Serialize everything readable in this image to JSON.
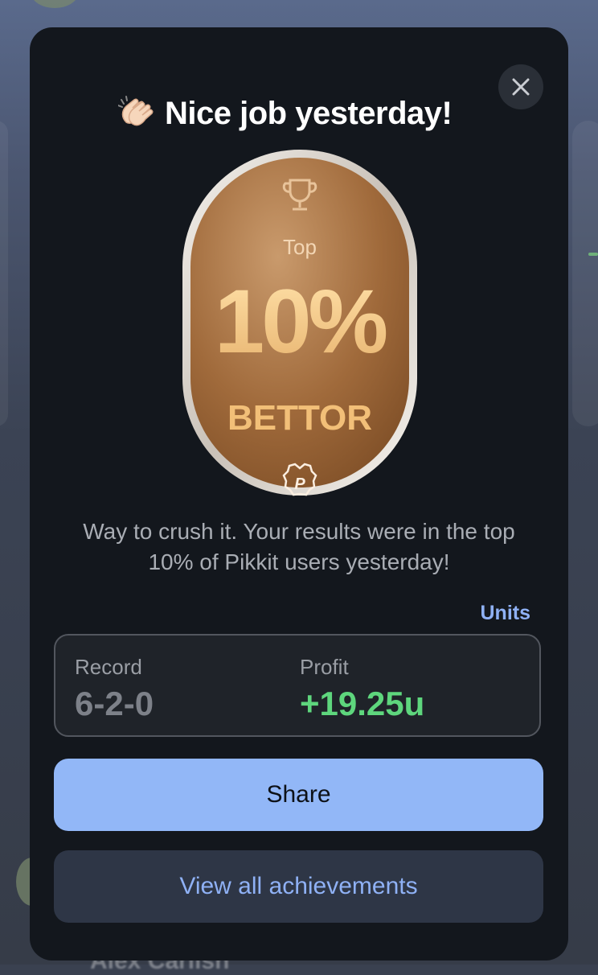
{
  "modal": {
    "title": "Nice job yesterday!",
    "badge": {
      "top_label": "Top",
      "percent": "10%",
      "subtitle": "BETTOR",
      "logo_letter": "P"
    },
    "description": "Way to crush it. Your results were in the top 10% of Pikkit users yesterday!",
    "units_label": "Units",
    "stats": {
      "record_label": "Record",
      "record_value": "6-2-0",
      "profit_label": "Profit",
      "profit_value": "+19.25u"
    },
    "share_label": "Share",
    "view_all_label": "View all achievements"
  },
  "background": {
    "user_name": "Alex Carlish"
  },
  "colors": {
    "modal_bg": "#13171d",
    "accent_blue": "#92b7f7",
    "link_blue": "#8fb1f5",
    "profit_green": "#5ed67d",
    "badge_bronze": "#a46c3c"
  }
}
